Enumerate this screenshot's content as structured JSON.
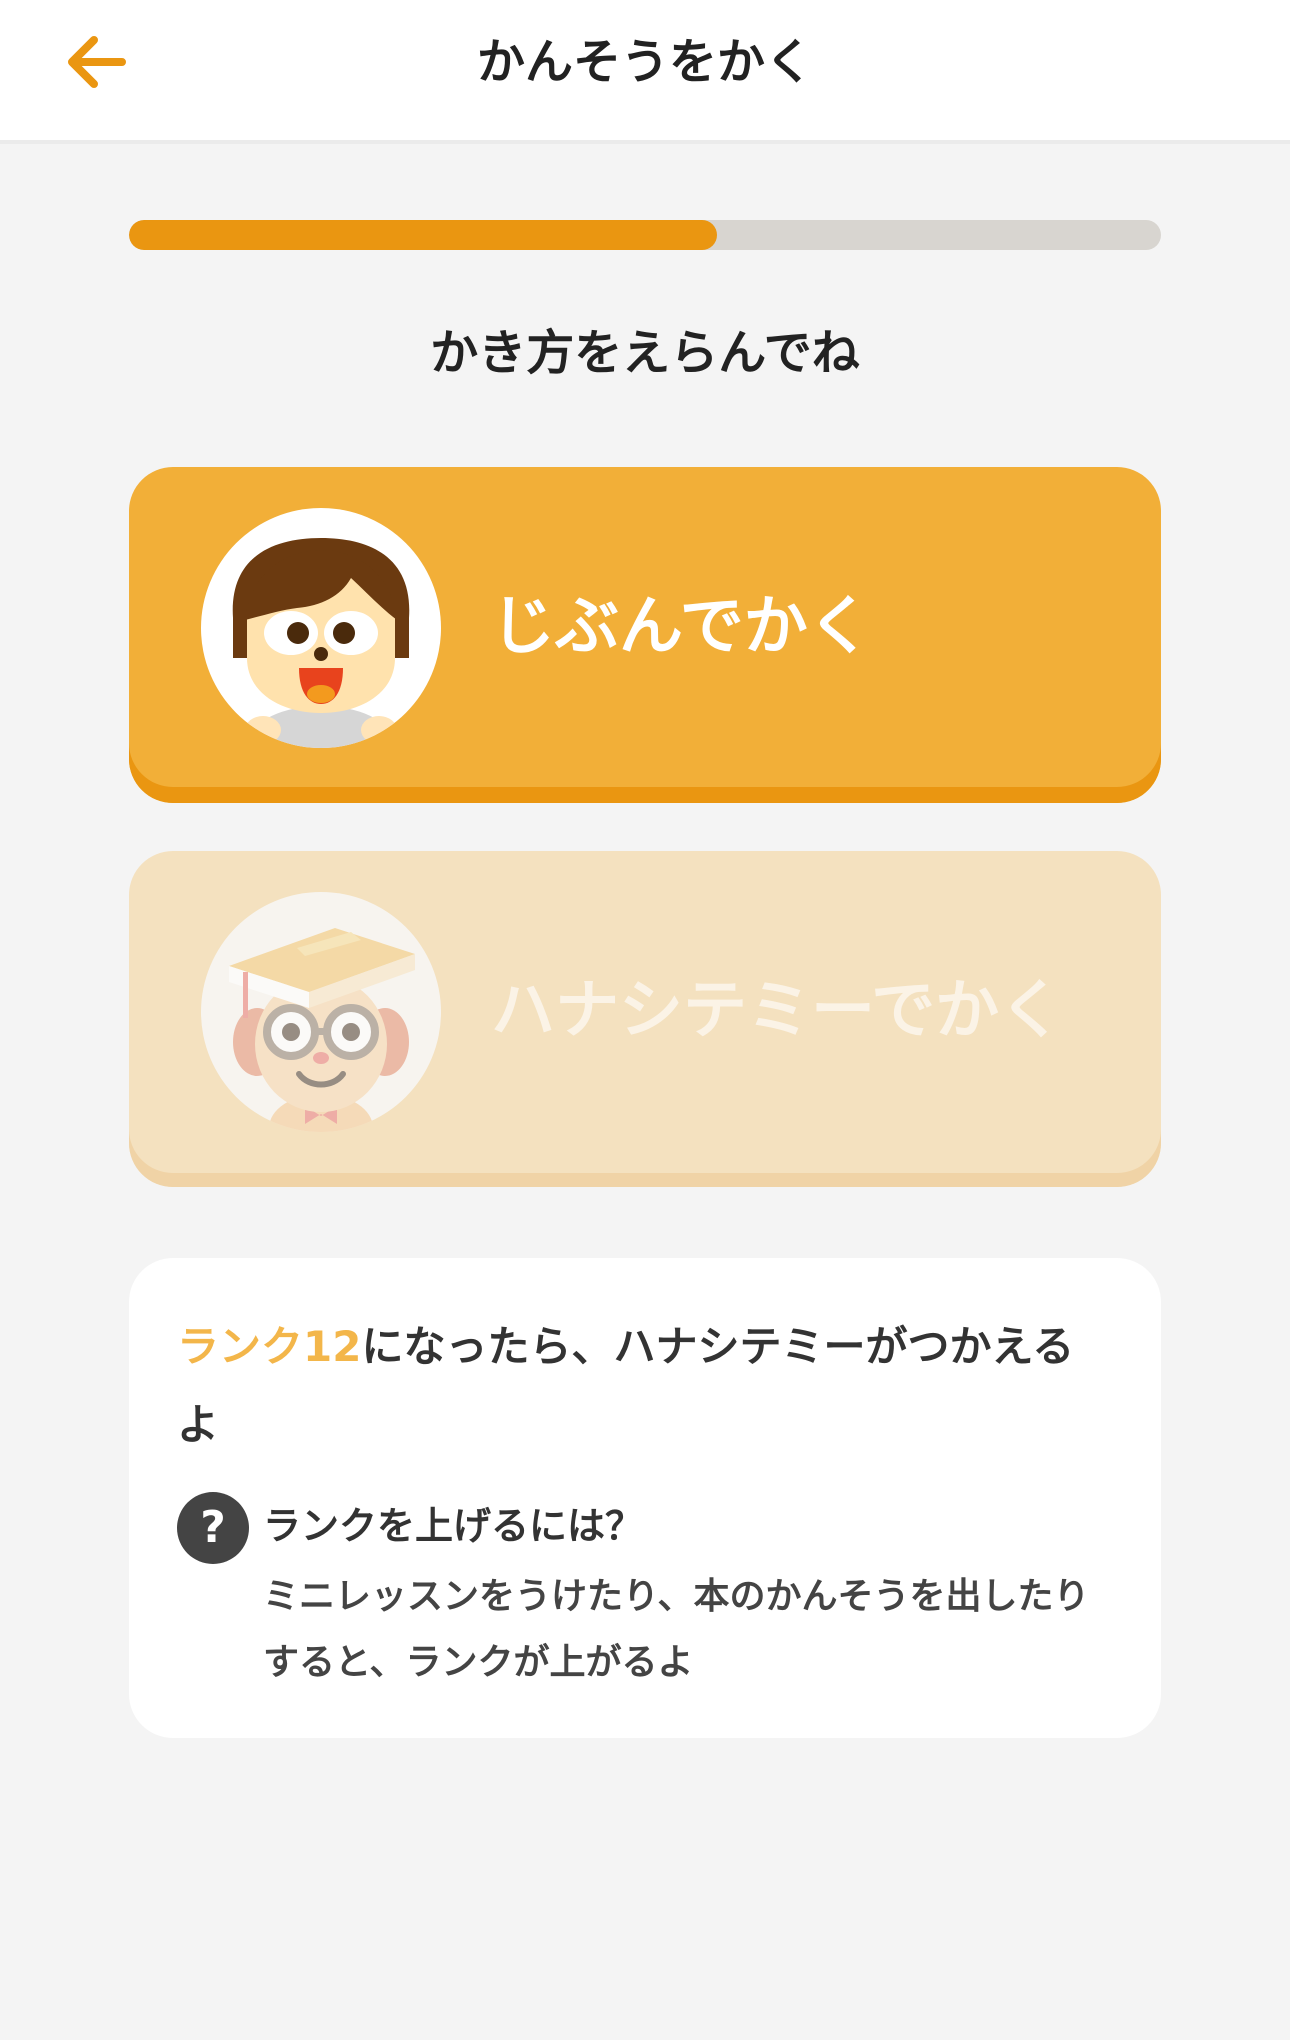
{
  "header": {
    "title": "かんそうをかく",
    "back_icon": "arrow-left-icon"
  },
  "progress": {
    "fraction": 0.57
  },
  "question": "かき方をえらんでね",
  "options": [
    {
      "label": "じぶんでかく",
      "icon": "child-avatar-icon",
      "enabled": true
    },
    {
      "label": "ハナシテミーでかく",
      "icon": "teacher-avatar-icon",
      "enabled": false
    }
  ],
  "info": {
    "rank_label": "ランク12",
    "message_rest": "になったら、ハナシテミーがつかえるよ",
    "help_icon": "?",
    "help_title": "ランクを上げるには？",
    "help_body": "ミニレッスンをうけたり、本のかんそうを出したりすると、ランクが上がるよ"
  },
  "colors": {
    "accent": "#ea9611",
    "option_primary": "#f2af38",
    "option_disabled": "#f4e1bf",
    "rank_highlight": "#f3b64a",
    "background": "#f4f4f4"
  }
}
